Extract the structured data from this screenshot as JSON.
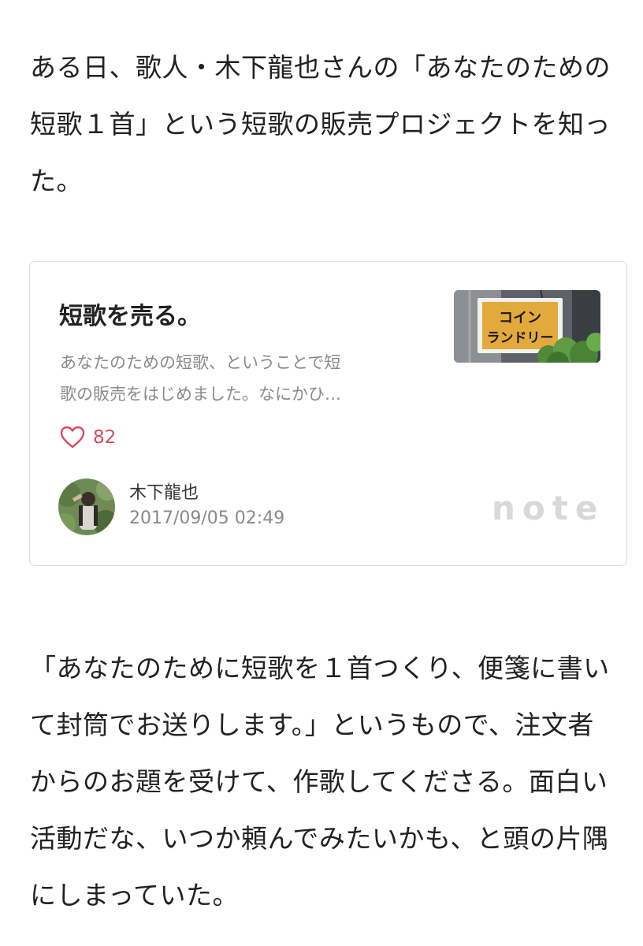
{
  "intro_paragraph": {
    "lines": [
      "ある日、歌人・木下龍也さんの「あなたのための",
      "短歌１首」という短歌の販売プロジェクトを知っ",
      "た。"
    ]
  },
  "embed_card": {
    "title": "短歌を売る。",
    "excerpt_lines": [
      "あなたのための短歌、ということで短",
      "歌の販売をはじめました。なにかひ…"
    ],
    "thumbnail": {
      "sign_line1": "コイン",
      "sign_line2": "ランドリー"
    },
    "likes": {
      "icon": "heart-outline-icon",
      "count": "82"
    },
    "author": {
      "name": "木下龍也",
      "date": "2017/09/05 02:49"
    },
    "brand_logo": "note",
    "colors": {
      "like_accent": "#e0475b",
      "border": "#dcdcdc",
      "muted_text": "#8a8a8a"
    }
  },
  "body_paragraph": {
    "lines": [
      "「あなたのために短歌を１首つくり、便箋に書い",
      "て封筒でお送りします。」というもので、注文者",
      "からのお題を受けて、作歌してくださる。面白い",
      "活動だな、いつか頼んでみたいかも、と頭の片隅",
      "にしまっていた。"
    ]
  }
}
